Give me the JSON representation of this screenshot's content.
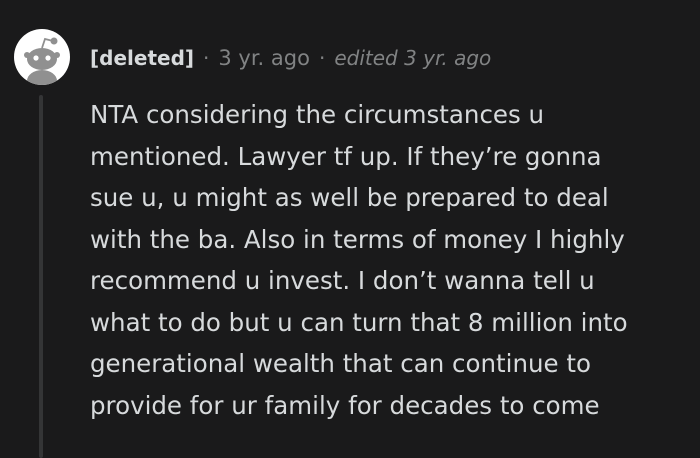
{
  "comment": {
    "author": "[deleted]",
    "separator": "·",
    "time": "3 yr. ago",
    "edited": "edited 3 yr. ago",
    "avatar_icon": "reddit-snoo-icon",
    "body_lines": [
      "NTA considering the circumstances u",
      "mentioned. Lawyer tf up. If they’re gonna",
      "sue u, u might as well be prepared to deal",
      "with the ba. Also in terms of money I highly",
      "recommend u invest. I don’t wanna tell u",
      "what to do but u can turn that 8 million into",
      "generational wealth that can continue to",
      "provide for ur family for decades to come"
    ]
  },
  "colors": {
    "background": "#1a1a1b",
    "text": "#d7dadc",
    "meta": "#818384",
    "thread_line": "#343536",
    "avatar_bg": "#ffffff",
    "avatar_figure": "#909090"
  }
}
